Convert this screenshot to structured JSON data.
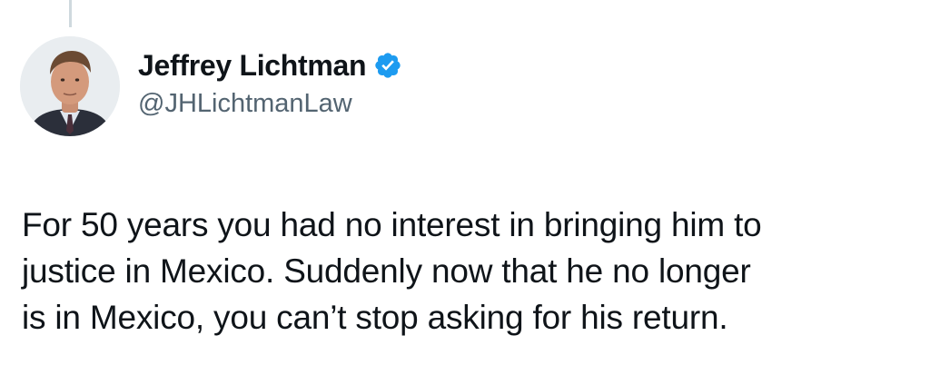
{
  "author": {
    "display_name": "Jeffrey Lichtman",
    "handle": "@JHLichtmanLaw",
    "verified": true,
    "verified_color": "#1d9bf0"
  },
  "tweet": {
    "lines": [
      "For 50 years you had no interest in bringing him to",
      "justice in Mexico. Suddenly now that he no longer",
      "is in Mexico, you can’t stop asking for his return."
    ]
  },
  "icons": {
    "avatar": "profile-photo",
    "verified": "verified-badge-icon"
  }
}
